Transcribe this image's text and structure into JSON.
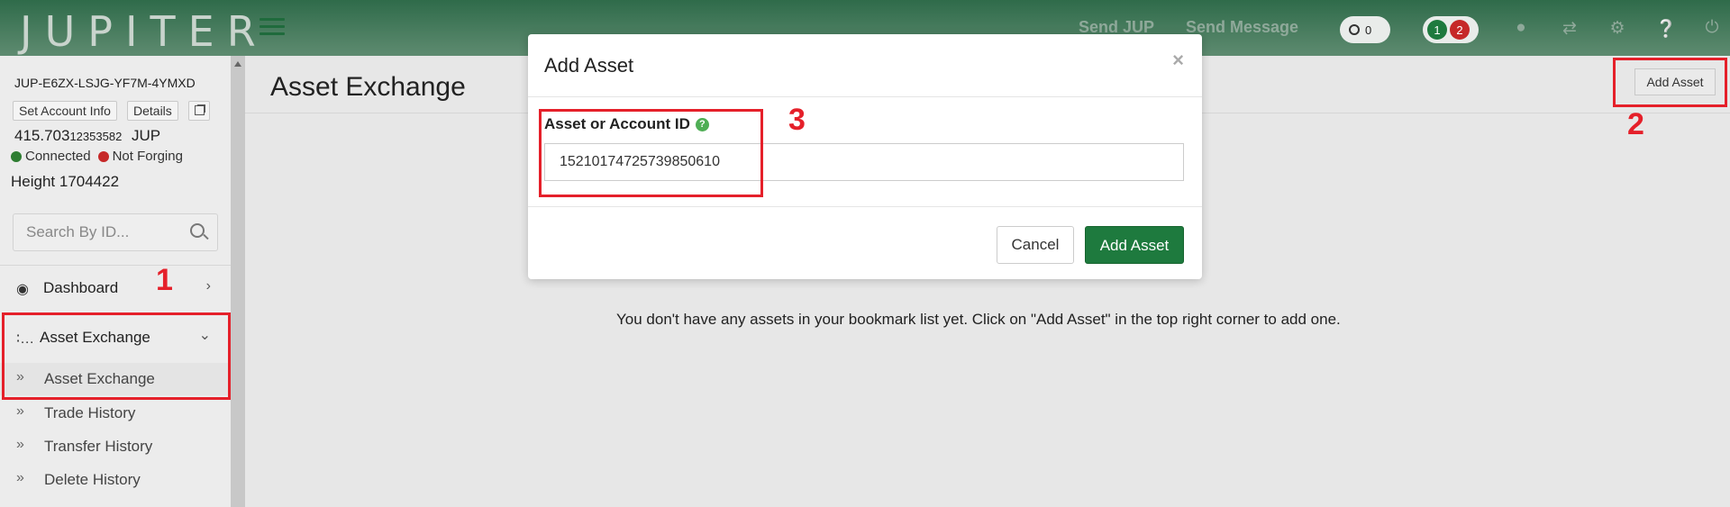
{
  "topbar": {
    "logo": "JUPITER",
    "links": {
      "send_jup": "Send JUP",
      "send_message": "Send Message"
    },
    "pill_count": "0",
    "badge_green": "1",
    "badge_red": "2"
  },
  "sidebar": {
    "account_id": "JUP-E6ZX-LSJG-YF7M-4YMXD",
    "set_account_info": "Set Account Info",
    "details": "Details",
    "balance_main": "415.703",
    "balance_decimals": "12353582",
    "balance_unit": "JUP",
    "connected": "Connected",
    "not_forging": "Not Forging",
    "height": "Height 1704422",
    "search_placeholder": "Search By ID...",
    "nav": {
      "dashboard": "Dashboard",
      "asset_exchange": "Asset Exchange"
    },
    "sub_items": [
      "Asset Exchange",
      "Trade History",
      "Transfer History",
      "Delete History"
    ]
  },
  "main": {
    "title": "Asset Exchange",
    "add_asset_button": "Add Asset",
    "empty_message": "You don't have any assets in your bookmark list yet. Click on \"Add Asset\" in the top right corner to add one."
  },
  "modal": {
    "title": "Add Asset",
    "close": "×",
    "field_label": "Asset or Account ID",
    "help": "?",
    "field_value": "15210174725739850610",
    "cancel": "Cancel",
    "submit": "Add Asset"
  },
  "annotations": {
    "step1": "1",
    "step2": "2",
    "step3": "3"
  },
  "colors": {
    "brand_green": "#1e7a3e",
    "annotation_red": "#e5202a",
    "connected_dot": "#2e7d32",
    "not_forging_dot": "#c62828"
  }
}
